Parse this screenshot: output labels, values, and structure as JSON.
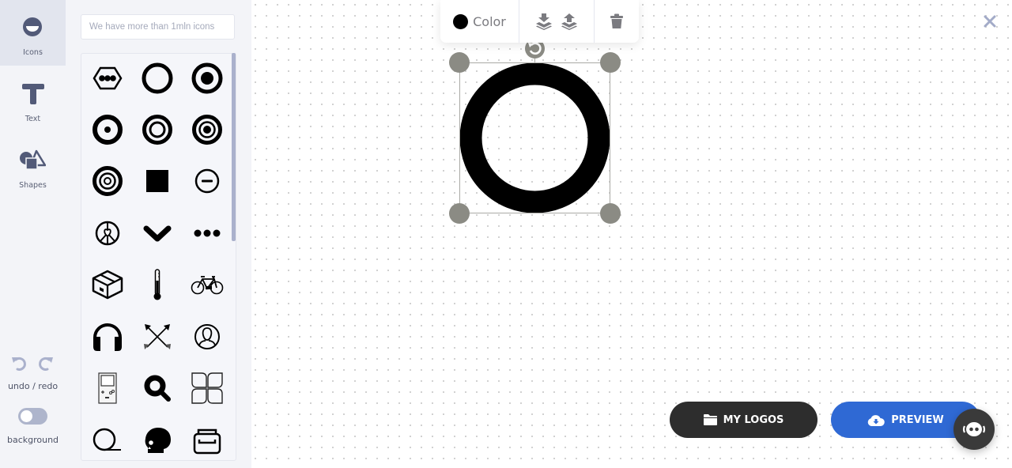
{
  "nav": {
    "items": [
      {
        "id": "icons",
        "label": "Icons",
        "icon": "smile-icon",
        "active": true
      },
      {
        "id": "text",
        "label": "Text",
        "icon": "text-t-icon",
        "active": false
      },
      {
        "id": "shapes",
        "label": "Shapes",
        "icon": "shapes-icon",
        "active": false
      }
    ],
    "undo_redo_label": "undo / redo",
    "background_label": "background",
    "background_toggle_on": false
  },
  "search": {
    "placeholder": "We have more than 1mln icons",
    "value": ""
  },
  "icon_grid": [
    "hexagon-dots-icon",
    "ring-icon",
    "ring-dot-icon",
    "ring-small-dot-icon",
    "double-ring-icon",
    "target-icon",
    "bullseye-icon",
    "square-icon",
    "minus-circle-icon",
    "peace-heart-icon",
    "chevron-down-icon",
    "ellipsis-icon",
    "box-icon",
    "thermometer-icon",
    "bicycle-icon",
    "headphones-icon",
    "crossed-arrows-icon",
    "user-circle-icon",
    "gameboy-icon",
    "magnifier-icon",
    "four-petals-icon",
    "loop-circle-icon",
    "skull-icon",
    "drawer-icon"
  ],
  "toolbar": {
    "color_label": "Color",
    "color_value": "#000000",
    "send_backward": "layer-down-icon",
    "bring_forward": "layer-up-icon",
    "delete": "trash-icon"
  },
  "canvas": {
    "selected_element": "ring-icon",
    "element_color": "#000000"
  },
  "buttons": {
    "my_logos": "MY LOGOS",
    "preview": "PREVIEW"
  },
  "colors": {
    "preview_blue": "#2f69d4",
    "dark_button": "#2d2d2d",
    "sidebar_bg": "#f3f4f8",
    "accent_muted": "#aab1cc"
  }
}
